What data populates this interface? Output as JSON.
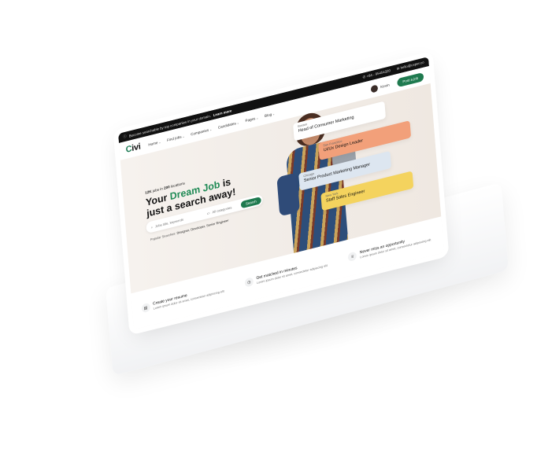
{
  "topbar": {
    "promo_text": "Become searchable by top companies in your domain.",
    "promo_link": "Learn more",
    "phone": "+84 - 95454320",
    "email": "hello@uxper.co"
  },
  "nav": {
    "logo": "Civi",
    "items": [
      "Home",
      "Find jobs",
      "Companies",
      "Candidates",
      "Pages",
      "Blog"
    ],
    "user_name": "Kevin",
    "post_job_label": "Post a job"
  },
  "hero": {
    "jobs_count": "12K",
    "jobs_text": "jobs in",
    "locations_count": "200",
    "locations_text": "locations",
    "headline_pre": "Your ",
    "headline_highlight": "Dream Job",
    "headline_post": " is",
    "headline_line2": "just a search away!",
    "search": {
      "keyword_placeholder": "Jobs title, keywords",
      "category_placeholder": "All categories",
      "button_label": "Search"
    },
    "popular_label": "Popular Searches:",
    "popular_terms": "Designer, Developer, Senior Engineer"
  },
  "job_cards": [
    {
      "location": "Boston",
      "title": "Head of Consumer Marketing",
      "color": "#ffffff"
    },
    {
      "location": "San Francisco",
      "title": "Ui/Ux Design Leader",
      "color": "#f2a07a"
    },
    {
      "location": "Chicago",
      "title": "Senior Product Marketing Manager",
      "color": "#dde6f0"
    },
    {
      "location": "New York",
      "title": "Staff Sales Engineer",
      "color": "#f4d35e"
    }
  ],
  "features": [
    {
      "title": "Create your resume",
      "desc": "Lorem ipsum dolor sit amet, consectetur adipiscing elit",
      "icon": "document-icon"
    },
    {
      "title": "Get matched in minutes",
      "desc": "Lorem ipsum dolor sit amet, consectetur adipiscing elit",
      "icon": "stopwatch-icon"
    },
    {
      "title": "Never miss an opportunity",
      "desc": "Lorem ipsum dolor sit amet, consectetur adipiscing elit",
      "icon": "trophy-icon"
    }
  ],
  "colors": {
    "brand_green": "#1f7a4f",
    "topbar_bg": "#111111"
  }
}
